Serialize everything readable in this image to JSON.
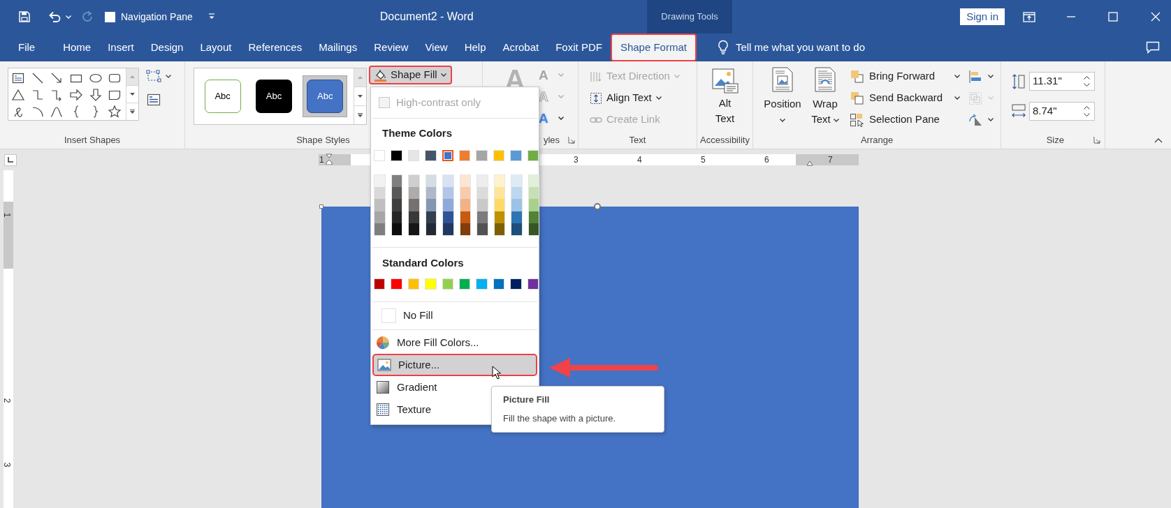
{
  "title_bar": {
    "navigation_pane": {
      "label": "Navigation Pane",
      "checked": false
    },
    "document_title": "Document2 - Word",
    "contextual_tab_group": "Drawing Tools",
    "sign_in": "Sign in"
  },
  "tabs": [
    {
      "label": "File",
      "selected": false,
      "highlighted": false
    },
    {
      "label": "Home",
      "selected": false,
      "highlighted": false
    },
    {
      "label": "Insert",
      "selected": false,
      "highlighted": false
    },
    {
      "label": "Design",
      "selected": false,
      "highlighted": false
    },
    {
      "label": "Layout",
      "selected": false,
      "highlighted": false
    },
    {
      "label": "References",
      "selected": false,
      "highlighted": false
    },
    {
      "label": "Mailings",
      "selected": false,
      "highlighted": false
    },
    {
      "label": "Review",
      "selected": false,
      "highlighted": false
    },
    {
      "label": "View",
      "selected": false,
      "highlighted": false
    },
    {
      "label": "Help",
      "selected": false,
      "highlighted": false
    },
    {
      "label": "Acrobat",
      "selected": false,
      "highlighted": false
    },
    {
      "label": "Foxit PDF",
      "selected": false,
      "highlighted": false
    },
    {
      "label": "Shape Format",
      "selected": true,
      "highlighted": true
    }
  ],
  "tell_me": "Tell me what you want to do",
  "ribbon": {
    "insert_shapes": {
      "label": "Insert Shapes"
    },
    "shape_styles": {
      "label": "Shape Styles",
      "presets": [
        {
          "label": "Abc",
          "kind": "outline",
          "selected": false
        },
        {
          "label": "Abc",
          "kind": "dark",
          "selected": false
        },
        {
          "label": "Abc",
          "kind": "filled",
          "selected": true
        }
      ],
      "shape_fill": {
        "label": "Shape Fill",
        "expanded": true,
        "highlighted": true
      }
    },
    "wordart_styles": {
      "label": "yles",
      "quick_styles": {
        "glyph": "A",
        "disabled": true
      },
      "tools": [
        {
          "glyph": "A",
          "kind": "fill",
          "disabled": true
        },
        {
          "glyph": "A",
          "kind": "outline",
          "disabled": true
        },
        {
          "glyph": "A",
          "kind": "effects",
          "disabled": false
        }
      ]
    },
    "text": {
      "label": "Text",
      "commands": [
        {
          "label": "Text Direction",
          "kind": "text_direction",
          "disabled": true,
          "dropdown": true
        },
        {
          "label": "Align Text",
          "kind": "align",
          "disabled": false,
          "dropdown": true
        },
        {
          "label": "Create Link",
          "kind": "link",
          "disabled": true,
          "dropdown": false
        }
      ]
    },
    "accessibility": {
      "label": "Accessibility",
      "alt_text": "Alt Text"
    },
    "arrange": {
      "label": "Arrange",
      "large": [
        {
          "label": "Position",
          "kind": "position"
        },
        {
          "label": "Wrap Text",
          "kind": "wrap"
        }
      ],
      "commands": [
        {
          "label": "Bring Forward",
          "kind": "bring_forward",
          "dropdown": true
        },
        {
          "label": "Send Backward",
          "kind": "send_backward",
          "dropdown": true
        },
        {
          "label": "Selection Pane",
          "kind": "selection_pane",
          "dropdown": false
        }
      ],
      "tools": [
        {
          "kind": "align",
          "disabled": false
        },
        {
          "kind": "group",
          "disabled": true
        },
        {
          "kind": "rotate",
          "disabled": false
        }
      ]
    },
    "size": {
      "label": "Size",
      "height": "11.31\"",
      "width": "8.74\""
    }
  },
  "ruler": {
    "horizontal": [
      "1",
      "3",
      "4",
      "5",
      "6",
      "7"
    ],
    "vertical": [
      "1",
      "2",
      "3"
    ]
  },
  "shape_fill_menu": {
    "high_contrast": {
      "label": "High-contrast only",
      "checked": false,
      "disabled": true
    },
    "theme_heading": "Theme Colors",
    "theme_colors": [
      {
        "color": "#ffffff",
        "selected": false
      },
      {
        "color": "#000000",
        "selected": false
      },
      {
        "color": "#e7e6e6",
        "selected": false
      },
      {
        "color": "#44546a",
        "selected": false
      },
      {
        "color": "#4472c4",
        "selected": true
      },
      {
        "color": "#ed7d31",
        "selected": false
      },
      {
        "color": "#a5a5a5",
        "selected": false
      },
      {
        "color": "#ffc000",
        "selected": false
      },
      {
        "color": "#5b9bd5",
        "selected": false
      },
      {
        "color": "#70ad47",
        "selected": false
      }
    ],
    "shades": [
      {
        "cells": [
          {
            "color": "#f2f2f2"
          },
          {
            "color": "#d9d9d9"
          },
          {
            "color": "#bfbfbf"
          },
          {
            "color": "#a6a6a6"
          },
          {
            "color": "#7f7f7f"
          }
        ]
      },
      {
        "cells": [
          {
            "color": "#7f7f7f"
          },
          {
            "color": "#595959"
          },
          {
            "color": "#3f3f3f"
          },
          {
            "color": "#262626"
          },
          {
            "color": "#0d0d0d"
          }
        ]
      },
      {
        "cells": [
          {
            "color": "#d0cece"
          },
          {
            "color": "#aeabab"
          },
          {
            "color": "#757171"
          },
          {
            "color": "#3a3838"
          },
          {
            "color": "#171616"
          }
        ]
      },
      {
        "cells": [
          {
            "color": "#d6dce4"
          },
          {
            "color": "#adb9ca"
          },
          {
            "color": "#8497b0"
          },
          {
            "color": "#333f4f"
          },
          {
            "color": "#222a35"
          }
        ]
      },
      {
        "cells": [
          {
            "color": "#d9e2f3"
          },
          {
            "color": "#b4c6e7"
          },
          {
            "color": "#8eaadb"
          },
          {
            "color": "#2f5496"
          },
          {
            "color": "#1f3864"
          }
        ]
      },
      {
        "cells": [
          {
            "color": "#fbe5d5"
          },
          {
            "color": "#f7cbac"
          },
          {
            "color": "#f4b183"
          },
          {
            "color": "#c55a11"
          },
          {
            "color": "#833c0b"
          }
        ]
      },
      {
        "cells": [
          {
            "color": "#ededed"
          },
          {
            "color": "#dbdbdb"
          },
          {
            "color": "#c9c9c9"
          },
          {
            "color": "#7b7b7b"
          },
          {
            "color": "#525252"
          }
        ]
      },
      {
        "cells": [
          {
            "color": "#fff2cc"
          },
          {
            "color": "#fee599"
          },
          {
            "color": "#ffd965"
          },
          {
            "color": "#bf9000"
          },
          {
            "color": "#7f6000"
          }
        ]
      },
      {
        "cells": [
          {
            "color": "#deebf6"
          },
          {
            "color": "#bdd7ee"
          },
          {
            "color": "#9cc3e5"
          },
          {
            "color": "#2e75b5"
          },
          {
            "color": "#1e4e79"
          }
        ]
      },
      {
        "cells": [
          {
            "color": "#e2efd9"
          },
          {
            "color": "#c5e0b3"
          },
          {
            "color": "#a8d08d"
          },
          {
            "color": "#538135"
          },
          {
            "color": "#375623"
          }
        ]
      }
    ],
    "standard_heading": "Standard Colors",
    "standard_colors": [
      {
        "color": "#c00000"
      },
      {
        "color": "#ff0000"
      },
      {
        "color": "#ffc000"
      },
      {
        "color": "#ffff00"
      },
      {
        "color": "#92d050"
      },
      {
        "color": "#00b050"
      },
      {
        "color": "#00b0f0"
      },
      {
        "color": "#0070c0"
      },
      {
        "color": "#002060"
      },
      {
        "color": "#7030a0"
      }
    ],
    "items": [
      {
        "label": "No Fill",
        "kind": "no_fill",
        "hovered": false,
        "highlighted": false
      },
      {
        "label": "More Fill Colors...",
        "kind": "more_colors",
        "hovered": false,
        "highlighted": false
      },
      {
        "label": "Picture...",
        "kind": "picture",
        "hovered": true,
        "highlighted": true
      },
      {
        "label": "Gradient",
        "kind": "gradient",
        "hovered": false,
        "highlighted": false
      },
      {
        "label": "Texture",
        "kind": "texture",
        "hovered": false,
        "highlighted": false
      }
    ]
  },
  "tooltip": {
    "title": "Picture Fill",
    "body": "Fill the shape with a picture."
  }
}
